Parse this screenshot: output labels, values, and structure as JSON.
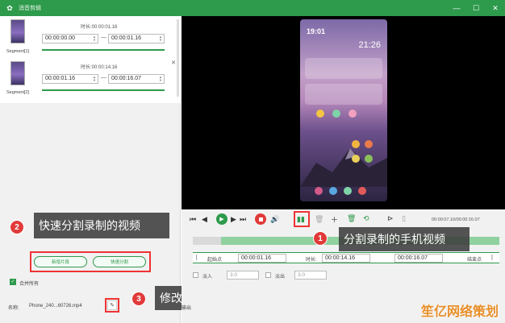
{
  "window": {
    "title": "消音剪辑",
    "controls": [
      "minimize",
      "maximize",
      "close"
    ]
  },
  "segments": [
    {
      "label": "Segment[1]",
      "duration_label": "时长:",
      "duration": "00:00:01.16",
      "start": "00:00:00.00",
      "end": "00:00:01.16"
    },
    {
      "label": "Segment[2]",
      "duration_label": "时长:",
      "duration": "00:00:14.16",
      "start": "00:00:01.16",
      "end": "00:00:16.07"
    }
  ],
  "callouts": {
    "c1": {
      "num": "1",
      "text": "分割录制的手机视频"
    },
    "c2": {
      "num": "2",
      "text": "快速分割录制的视频"
    },
    "c3": {
      "num": "3",
      "text": "修改视频的名称"
    }
  },
  "left_actions": {
    "add_segment": "新增片段",
    "quick_split": "快速分割"
  },
  "merge_all": "合并所有",
  "name_row": {
    "label": "名称:",
    "filename": "Phone_240...60726.mp4"
  },
  "phone_screen": {
    "status_time": "19:01",
    "clock": "21:26"
  },
  "playback": {
    "time_readout": "00:00:07.16/00:00:16.07"
  },
  "range": {
    "start_label": "起始点",
    "start_value": "00:00:01.16",
    "duration_label": "时长:",
    "duration_value": "00:00:14.16",
    "end_value": "00:00:16.07",
    "end_label": "结束点"
  },
  "fade": {
    "fade_in_label": "淡入",
    "fade_in_value": "3.0",
    "fade_out_label": "淡出",
    "fade_out_value": "3.0"
  },
  "output_label": "输出",
  "watermark": "笙亿网络策划",
  "colors": {
    "accent": "#2e9a4c",
    "callout_red": "#e13a3a",
    "timeline_fill": "#8fd19f"
  }
}
